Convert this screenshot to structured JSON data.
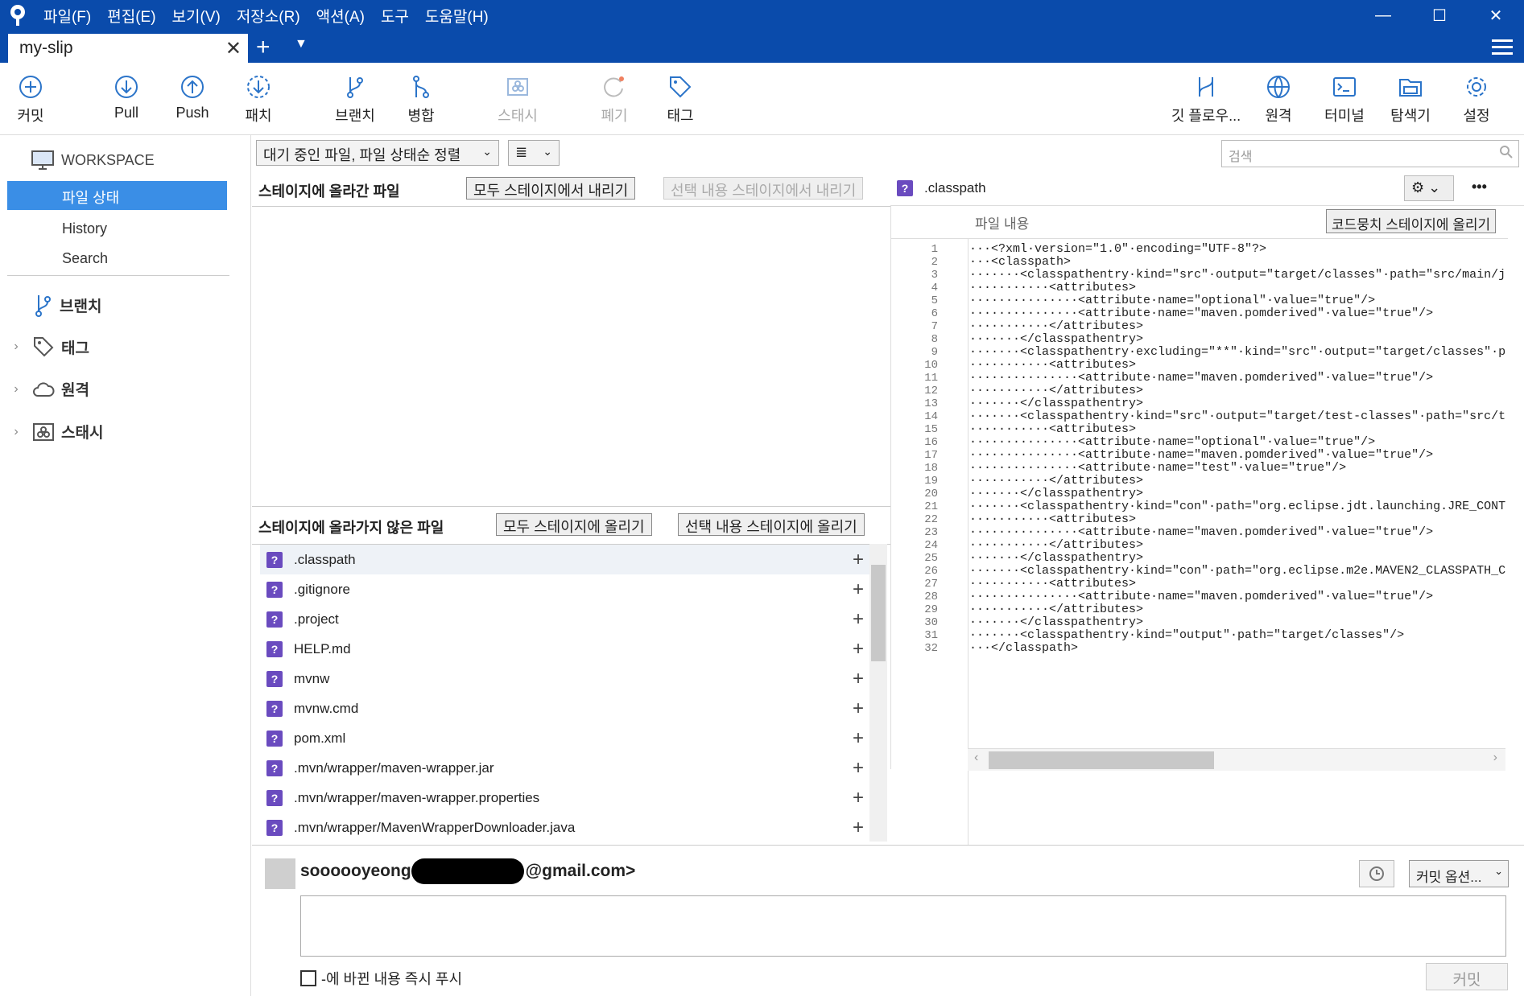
{
  "menu": [
    "파일(F)",
    "편집(E)",
    "보기(V)",
    "저장소(R)",
    "액션(A)",
    "도구",
    "도움말(H)"
  ],
  "window": {
    "minimize": "—",
    "maximize": "☐",
    "close": "✕"
  },
  "tab": {
    "name": "my-slip",
    "close": "✕",
    "new": "+"
  },
  "toolbar": {
    "commit": "커밋",
    "pull": "Pull",
    "push": "Push",
    "fetch": "패치",
    "branch": "브랜치",
    "merge": "병합",
    "stash": "스태시",
    "discard": "폐기",
    "tag": "태그",
    "gitflow": "깃 플로우...",
    "remote": "원격",
    "terminal": "터미널",
    "explorer": "탐색기",
    "settings": "설정"
  },
  "sidebar": {
    "workspace": "WORKSPACE",
    "file_status": "파일 상태",
    "history": "History",
    "search": "Search",
    "branches": "브랜치",
    "tags": "태그",
    "remotes": "원격",
    "stashes": "스태시"
  },
  "filter": {
    "sort": "대기 중인 파일, 파일 상태순 정렬",
    "view": "≣"
  },
  "search_placeholder": "검색",
  "staged": {
    "title": "스테이지에 올라간 파일",
    "unstage_all": "모두 스테이지에서 내리기",
    "unstage_selected": "선택 내용 스테이지에서 내리기"
  },
  "unstaged": {
    "title": "스테이지에 올라가지 않은 파일",
    "stage_all": "모두 스테이지에 올리기",
    "stage_selected": "선택 내용 스테이지에 올리기",
    "files": [
      ".classpath",
      ".gitignore",
      ".project",
      "HELP.md",
      "mvnw",
      "mvnw.cmd",
      "pom.xml",
      ".mvn/wrapper/maven-wrapper.jar",
      ".mvn/wrapper/maven-wrapper.properties",
      ".mvn/wrapper/MavenWrapperDownloader.java"
    ]
  },
  "diff": {
    "filename": ".classpath",
    "content_label": "파일 내용",
    "stage_hunk": "코드뭉치 스테이지에 올리기",
    "more": "•••",
    "lines": [
      "···<?xml·version=\"1.0\"·encoding=\"UTF-8\"?>",
      "···<classpath>",
      "·······<classpathentry·kind=\"src\"·output=\"target/classes\"·path=\"src/main/j",
      "···········<attributes>",
      "···············<attribute·name=\"optional\"·value=\"true\"/>",
      "···············<attribute·name=\"maven.pomderived\"·value=\"true\"/>",
      "···········</attributes>",
      "·······</classpathentry>",
      "·······<classpathentry·excluding=\"**\"·kind=\"src\"·output=\"target/classes\"·p",
      "···········<attributes>",
      "···············<attribute·name=\"maven.pomderived\"·value=\"true\"/>",
      "···········</attributes>",
      "·······</classpathentry>",
      "·······<classpathentry·kind=\"src\"·output=\"target/test-classes\"·path=\"src/t",
      "···········<attributes>",
      "···············<attribute·name=\"optional\"·value=\"true\"/>",
      "···············<attribute·name=\"maven.pomderived\"·value=\"true\"/>",
      "···············<attribute·name=\"test\"·value=\"true\"/>",
      "···········</attributes>",
      "·······</classpathentry>",
      "·······<classpathentry·kind=\"con\"·path=\"org.eclipse.jdt.launching.JRE_CONT",
      "···········<attributes>",
      "···············<attribute·name=\"maven.pomderived\"·value=\"true\"/>",
      "···········</attributes>",
      "·······</classpathentry>",
      "·······<classpathentry·kind=\"con\"·path=\"org.eclipse.m2e.MAVEN2_CLASSPATH_C",
      "···········<attributes>",
      "···············<attribute·name=\"maven.pomderived\"·value=\"true\"/>",
      "···········</attributes>",
      "·······</classpathentry>",
      "·······<classpathentry·kind=\"output\"·path=\"target/classes\"/>",
      "···</classpath>"
    ]
  },
  "commit": {
    "author_prefix": "soooooyeong",
    "author_suffix": "@gmail.com>",
    "options": "커밋 옵션...",
    "push_now": "-에 바뀐 내용 즉시 푸시",
    "commit_button": "커밋"
  },
  "colors": {
    "titlebar": "#0a4bab",
    "selection": "#3a8ee6",
    "untracked_icon": "#6a4bbf"
  }
}
